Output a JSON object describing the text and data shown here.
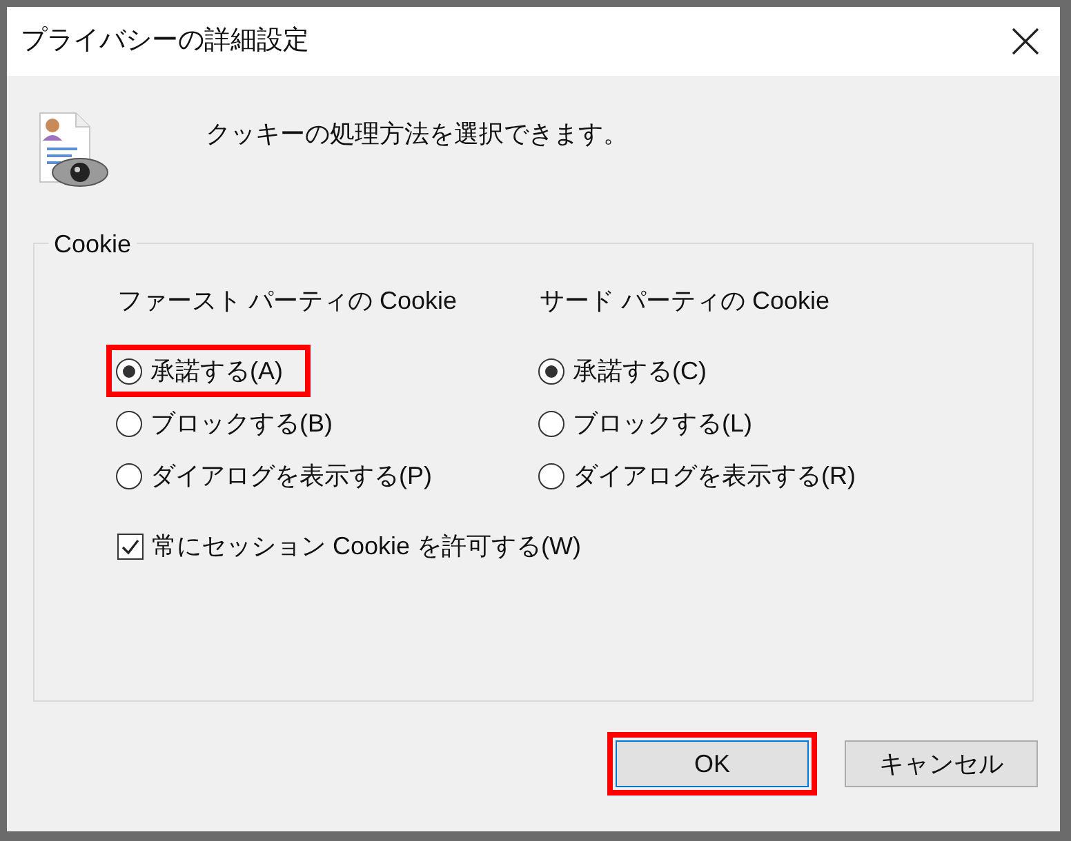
{
  "window": {
    "title": "プライバシーの詳細設定"
  },
  "description": "クッキーの処理方法を選択できます。",
  "group": {
    "label": "Cookie",
    "columns": [
      {
        "heading": "ファースト パーティの Cookie",
        "options": [
          {
            "label": "承諾する(A)",
            "selected": true,
            "highlighted": true
          },
          {
            "label": "ブロックする(B)",
            "selected": false,
            "highlighted": false
          },
          {
            "label": "ダイアログを表示する(P)",
            "selected": false,
            "highlighted": false
          }
        ]
      },
      {
        "heading": "サード パーティの Cookie",
        "options": [
          {
            "label": "承諾する(C)",
            "selected": true,
            "highlighted": false
          },
          {
            "label": "ブロックする(L)",
            "selected": false,
            "highlighted": false
          },
          {
            "label": "ダイアログを表示する(R)",
            "selected": false,
            "highlighted": false
          }
        ]
      }
    ],
    "checkbox": {
      "label": "常にセッション Cookie を許可する(W)",
      "checked": true
    }
  },
  "buttons": [
    {
      "label": "OK",
      "default": true,
      "highlighted": true
    },
    {
      "label": "キャンセル",
      "default": false,
      "highlighted": false
    }
  ]
}
